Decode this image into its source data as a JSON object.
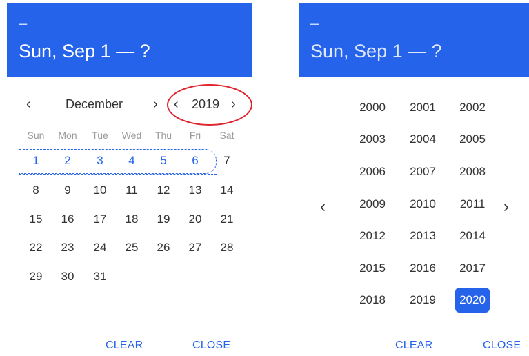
{
  "left": {
    "header": {
      "dash": "–",
      "title": "Sun, Sep 1 — ?"
    },
    "nav": {
      "prev": "‹",
      "month": "December",
      "month_next": "›",
      "year_prev": "‹",
      "year": "2019",
      "year_next": "›"
    },
    "weekdays": [
      "Sun",
      "Mon",
      "Tue",
      "Wed",
      "Thu",
      "Fri",
      "Sat"
    ],
    "weeks": [
      [
        "1",
        "2",
        "3",
        "4",
        "5",
        "6",
        "7"
      ],
      [
        "8",
        "9",
        "10",
        "11",
        "12",
        "13",
        "14"
      ],
      [
        "15",
        "16",
        "17",
        "18",
        "19",
        "20",
        "21"
      ],
      [
        "22",
        "23",
        "24",
        "25",
        "26",
        "27",
        "28"
      ],
      [
        "29",
        "30",
        "31"
      ]
    ],
    "actions": {
      "clear": "CLEAR",
      "close": "CLOSE"
    }
  },
  "right": {
    "header": {
      "dash": "–",
      "title": "Sun, Sep 1 — ?"
    },
    "nav": {
      "prev": "‹",
      "next": "›"
    },
    "years": [
      "2000",
      "2001",
      "2002",
      "2003",
      "2004",
      "2005",
      "2006",
      "2007",
      "2008",
      "2009",
      "2010",
      "2011",
      "2012",
      "2013",
      "2014",
      "2015",
      "2016",
      "2017",
      "2018",
      "2019",
      "2020"
    ],
    "selected_year": "2020",
    "actions": {
      "clear": "CLEAR",
      "close": "CLOSE"
    }
  },
  "colors": {
    "accent": "#2563EB",
    "annotation": "#E0242E"
  }
}
